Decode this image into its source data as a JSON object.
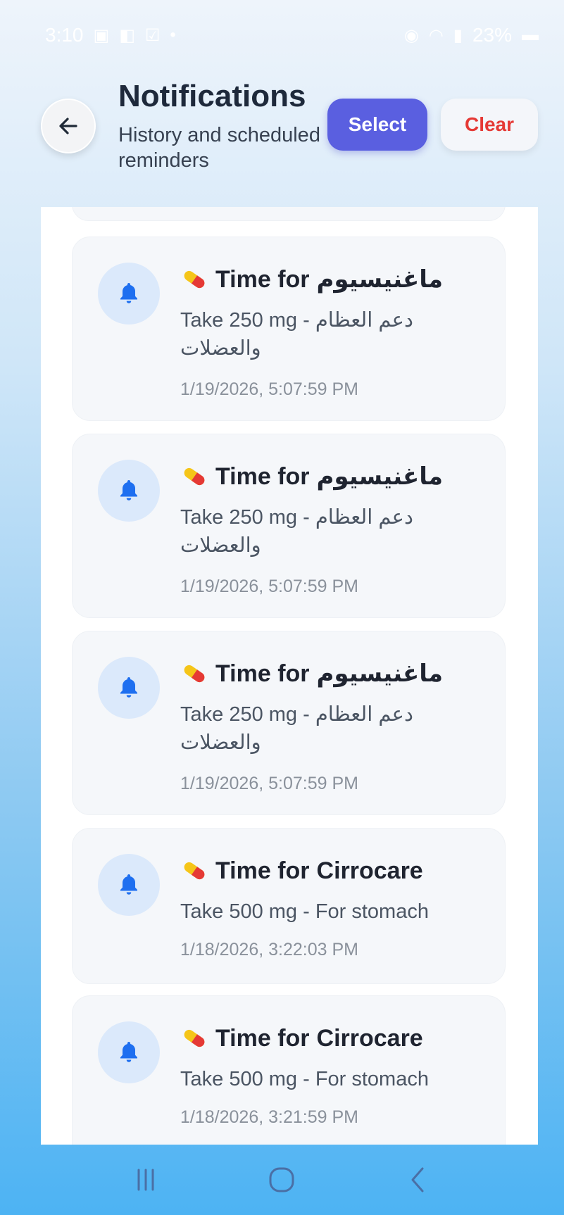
{
  "status_bar": {
    "time": "3:10",
    "battery": "23%"
  },
  "header": {
    "title": "Notifications",
    "subtitle": "History and scheduled reminders",
    "select_label": "Select",
    "clear_label": "Clear"
  },
  "notifications": [
    {
      "title_prefix": "Time for",
      "med_name": "ماغنيسيوم",
      "body": "Take 250 mg - دعم العظام والعضلات",
      "time": "1/19/2026, 5:07:59 PM",
      "icon": "bell-icon"
    },
    {
      "title_prefix": "Time for",
      "med_name": "ماغنيسيوم",
      "body": "Take 250 mg - دعم العظام والعضلات",
      "time": "1/19/2026, 5:07:59 PM",
      "icon": "bell-icon"
    },
    {
      "title_prefix": "Time for",
      "med_name": "ماغنيسيوم",
      "body": "Take 250 mg - دعم العظام والعضلات",
      "time": "1/19/2026, 5:07:59 PM",
      "icon": "bell-icon"
    },
    {
      "title_prefix": "Time for",
      "med_name": "Cirrocare",
      "body": "Take 500 mg - For stomach",
      "time": "1/18/2026, 3:22:03 PM",
      "icon": "bell-icon"
    },
    {
      "title_prefix": "Time for",
      "med_name": "Cirrocare",
      "body": "Take 500 mg - For stomach",
      "time": "1/18/2026, 3:21:59 PM",
      "icon": "bell-icon"
    }
  ],
  "colors": {
    "accent": "#5a5fe0",
    "danger": "#e53935",
    "bell": "#1e6ff0"
  }
}
